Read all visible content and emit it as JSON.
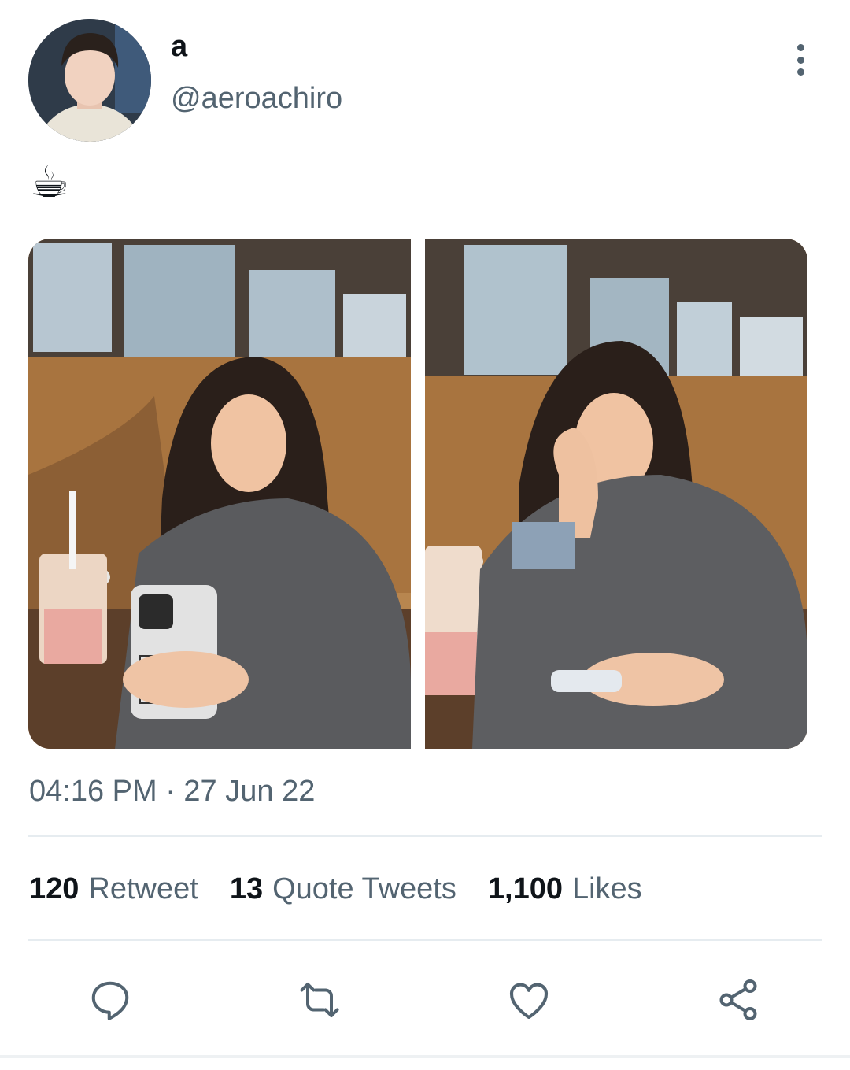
{
  "user": {
    "display_name": "a",
    "handle": "@aeroachiro"
  },
  "tweet": {
    "text": "☕",
    "timestamp": "04:16 PM · 27 Jun 22"
  },
  "stats": [
    {
      "value": "120",
      "label": "Retweet"
    },
    {
      "value": "13",
      "label": "Quote Tweets"
    },
    {
      "value": "1,100",
      "label": "Likes"
    }
  ],
  "colors": {
    "secondary_text": "#536471",
    "primary_text": "#0f1419",
    "divider": "#e6ecf0"
  },
  "icons": {
    "more": "vertical-dots-icon",
    "reply": "reply-bubble-icon",
    "retweet": "retweet-arrows-icon",
    "like": "heart-icon",
    "share": "share-nodes-icon"
  }
}
